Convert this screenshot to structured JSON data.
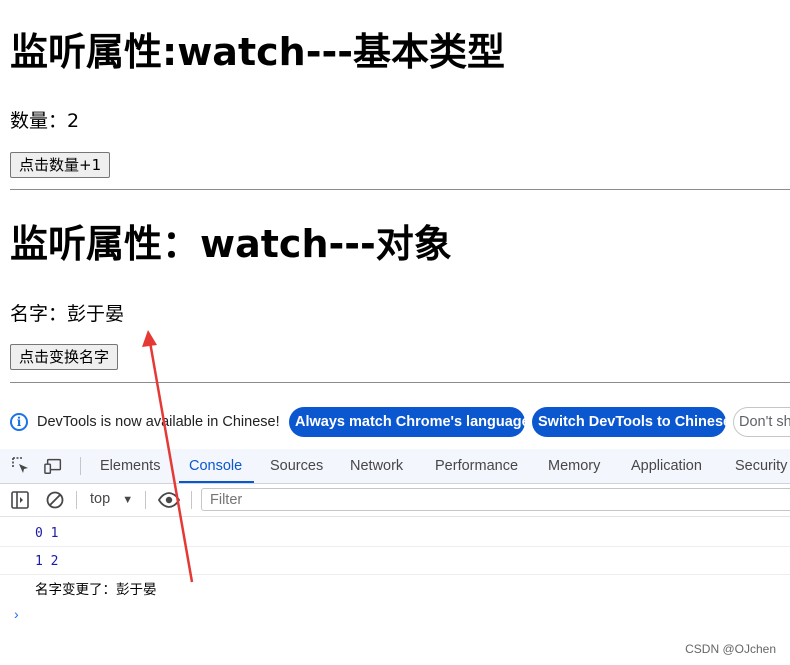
{
  "content": {
    "section1": {
      "title": "监听属性:watch---基本类型",
      "count_label": "数量：2",
      "button": "点击数量+1"
    },
    "section2": {
      "title": "监听属性：watch---对象",
      "name_label": "名字：彭于晏",
      "button": "点击变换名字"
    }
  },
  "devtools": {
    "infobar": {
      "message": "DevTools is now available in Chinese!",
      "btn_match": "Always match Chrome's language",
      "btn_switch": "Switch DevTools to Chinese",
      "btn_dont": "Don't show"
    },
    "tabs": [
      "Elements",
      "Console",
      "Sources",
      "Network",
      "Performance",
      "Memory",
      "Application",
      "Security"
    ],
    "active_tab": "Console",
    "toolbar": {
      "context": "top",
      "filter_placeholder": "Filter"
    },
    "console_logs": [
      {
        "text": "0 1"
      },
      {
        "text": "1 2"
      },
      {
        "text": "名字变更了：彭于晏"
      }
    ],
    "prompt": "›"
  },
  "watermark": "CSDN @OJchen",
  "colors": {
    "accent": "#0b57d0",
    "annotation_arrow": "#e53935"
  }
}
